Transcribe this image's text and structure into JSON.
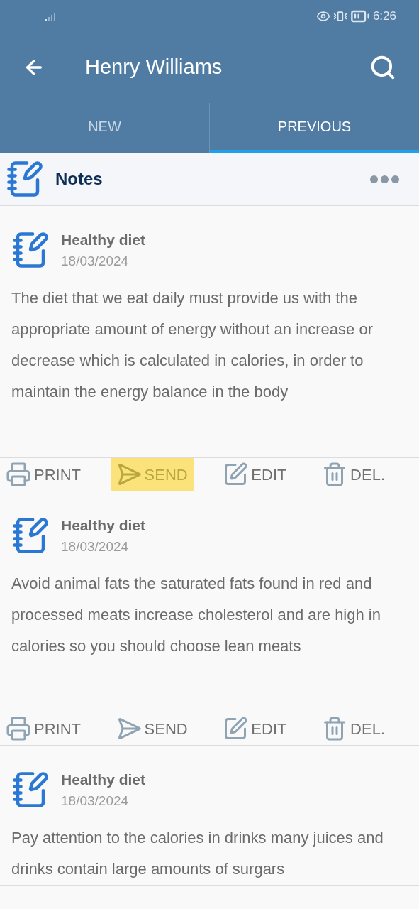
{
  "status_bar": {
    "time": "6:26"
  },
  "header": {
    "title": "Henry Williams"
  },
  "tabs": [
    {
      "label": "NEW",
      "selected": false
    },
    {
      "label": "PREVIOUS",
      "selected": true
    }
  ],
  "section": {
    "title": "Notes"
  },
  "notes": [
    {
      "title": "Healthy diet",
      "date": "18/03/2024",
      "text": "The diet that we eat daily must provide us with the appropriate amount of energy without an increase or decrease which is calculated in calories, in order to maintain the energy balance in the body",
      "actions": [
        {
          "kind": "print",
          "label": "PRINT",
          "highlighted": false
        },
        {
          "kind": "send",
          "label": "SEND",
          "highlighted": true
        },
        {
          "kind": "edit",
          "label": "EDIT",
          "highlighted": false
        },
        {
          "kind": "delete",
          "label": "DEL.",
          "highlighted": false
        }
      ]
    },
    {
      "title": "Healthy diet",
      "date": "18/03/2024",
      "text": "Avoid animal fats the saturated fats found in red and processed meats increase cholesterol and are high in calories so you should choose lean meats",
      "actions": [
        {
          "kind": "print",
          "label": "PRINT",
          "highlighted": false
        },
        {
          "kind": "send",
          "label": "SEND",
          "highlighted": false
        },
        {
          "kind": "edit",
          "label": "EDIT",
          "highlighted": false
        },
        {
          "kind": "delete",
          "label": "DEL.",
          "highlighted": false
        }
      ]
    },
    {
      "title": "Healthy diet",
      "date": "18/03/2024",
      "text": "Pay attention to the calories in drinks many juices and drinks contain large amounts of surgars"
    }
  ]
}
